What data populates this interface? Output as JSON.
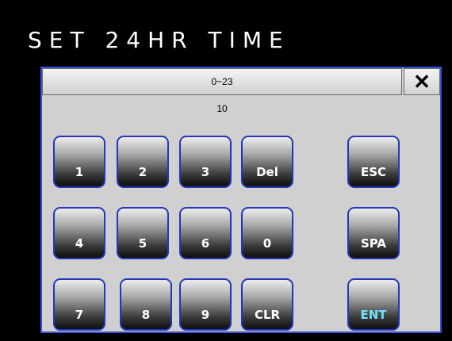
{
  "header": {
    "title": "SET 24HR TIME"
  },
  "dialog": {
    "range_label": "0~23",
    "close_symbol": "✕",
    "current_value": "10"
  },
  "keypad": {
    "keys": {
      "k1": "1",
      "k2": "2",
      "k3": "3",
      "del": "Del",
      "k4": "4",
      "k5": "5",
      "k6": "6",
      "k0": "0",
      "k7": "7",
      "k8": "8",
      "k9": "9",
      "clr": "CLR",
      "esc": "ESC",
      "spa": "SPA",
      "ent": "ENT"
    }
  },
  "colors": {
    "background": "#000000",
    "panel": "#d0d0d0",
    "panel_border": "#3a4fd8",
    "key_border": "#2436b8",
    "key_text": "#ffffff",
    "enter_text": "#6de3ff"
  }
}
